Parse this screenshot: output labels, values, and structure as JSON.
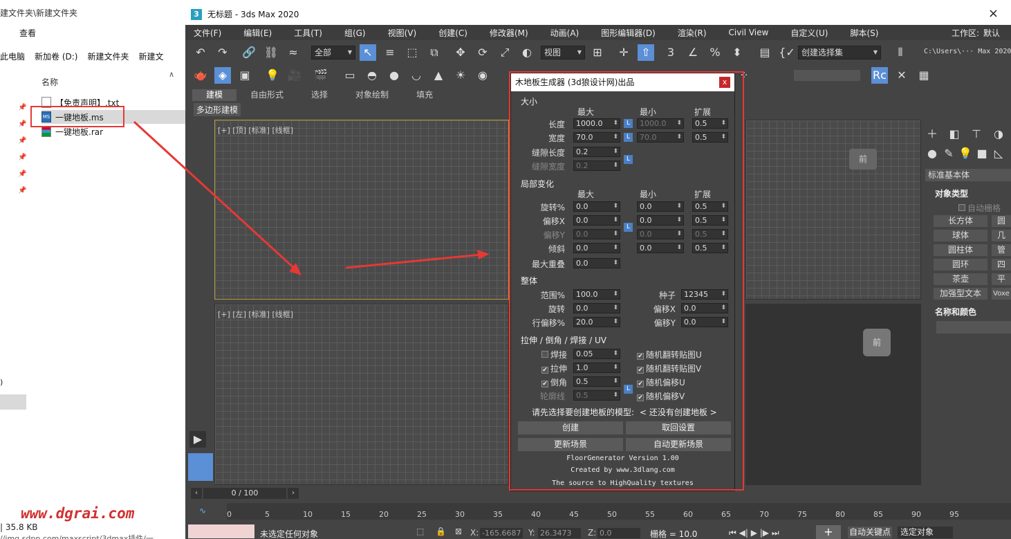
{
  "explorer": {
    "title_path": "建文件夹\\新建文件夹",
    "view_tab": "查看",
    "crumbs": [
      "此电脑",
      "新加卷 (D:)",
      "新建文件夹",
      "新建文"
    ],
    "column_name": "名称",
    "files": [
      {
        "name": "【免责声明】.txt"
      },
      {
        "name": "一键地板.ms"
      },
      {
        "name": "一键地板.rar"
      }
    ],
    "size": "35.8 KB",
    "url_fragment": "//img.sdpp.com/maxscript/3dmax插件/一",
    "side_paren": ")"
  },
  "watermark": "www.dgrai.com",
  "app": {
    "title": "无标题 - 3ds Max 2020",
    "close": "×",
    "menu": [
      "文件(F)",
      "编辑(E)",
      "工具(T)",
      "组(G)",
      "视图(V)",
      "创建(C)",
      "修改器(M)",
      "动画(A)",
      "图形编辑器(D)",
      "渲染(R)",
      "Civil View",
      "自定义(U)",
      "脚本(S)"
    ],
    "workspace_label": "工作区:",
    "workspace_value": "默认",
    "selection_filter": "全部",
    "view_dropdown": "视图",
    "selection_set": "创建选择集",
    "path_field": "C:\\Users\\··· Max 2020",
    "ribbon_tabs": [
      "建模",
      "自由形式",
      "选择",
      "对象绘制",
      "填充"
    ],
    "ribbon_sub": "多边形建模",
    "viewport_top_label": "[+] [顶] [标准] [线框]",
    "viewport_left_label": "[+] [左] [标准] [线框]",
    "viewcube_top": "前",
    "viewcube_left": "前"
  },
  "dialog": {
    "title": "木地板生成器 (3d狼设计网)出品",
    "close": "x",
    "size": {
      "heading": "大小",
      "col_max": "最大",
      "col_min": "最小",
      "col_ext": "扩展",
      "rows": [
        {
          "label": "长度",
          "max": "1000.0",
          "min": "1000.0",
          "ext": "0.5"
        },
        {
          "label": "宽度",
          "max": "70.0",
          "min": "70.0",
          "ext": "0.5"
        }
      ],
      "gap_len_label": "缝隙长度",
      "gap_len": "0.2",
      "gap_wid_label": "缝隙宽度",
      "gap_wid": "0.2"
    },
    "local": {
      "heading": "局部变化",
      "col_max": "最大",
      "col_min": "最小",
      "col_ext": "扩展",
      "rows": [
        {
          "label": "旋转%",
          "max": "0.0",
          "min": "0.0",
          "ext": "0.5"
        },
        {
          "label": "偏移X",
          "max": "0.0",
          "min": "0.0",
          "ext": "0.5"
        },
        {
          "label": "偏移Y",
          "max": "0.0",
          "min": "0.0",
          "ext": "0.5"
        },
        {
          "label": "倾斜",
          "max": "0.0",
          "min": "0.0",
          "ext": "0.5"
        }
      ],
      "overlap_label": "最大重叠",
      "overlap": "0.0"
    },
    "whole": {
      "heading": "整体",
      "range_label": "范围%",
      "range": "100.0",
      "seed_label": "种子",
      "seed": "12345",
      "rot_label": "旋转",
      "rot": "0.0",
      "offx_label": "偏移X",
      "offx": "0.0",
      "rowoff_label": "行偏移%",
      "rowoff": "20.0",
      "offy_label": "偏移Y",
      "offy": "0.0"
    },
    "uv": {
      "heading": "拉伸 / 倒角 / 焊接 / UV",
      "weld_label": "焊接",
      "weld": "0.05",
      "extrude_label": "拉伸",
      "extrude": "1.0",
      "chamfer_label": "倒角",
      "chamfer": "0.5",
      "outline_label": "轮廓线",
      "outline": "0.5",
      "flip_u": "随机翻转贴图U",
      "flip_v": "随机翻转贴图V",
      "off_u": "随机偏移U",
      "off_v": "随机偏移V",
      "check": "✔"
    },
    "prompt": "请先选择要创建地板的模型:",
    "model_value": "< 还没有创建地板 >",
    "buttons": {
      "create": "创建",
      "undo": "取回设置",
      "update": "更新场景",
      "auto_update": "自动更新场景"
    },
    "footer": [
      "FloorGenerator Version 1.00",
      "Created by www.3dlang.com",
      "The source to HighQuality textures"
    ]
  },
  "command_panel": {
    "category": "标准基本体",
    "object_type": "对象类型",
    "autogrid": "自动栅格",
    "objects": [
      "长方体",
      "圆",
      "球体",
      "几",
      "圆柱体",
      "管",
      "圆环",
      "四",
      "茶壶",
      "平",
      "加强型文本",
      "Voxe"
    ],
    "name_color": "名称和颜色"
  },
  "timeline": {
    "frame": "0 / 100",
    "ticks": [
      "0",
      "5",
      "10",
      "15",
      "20",
      "25",
      "30",
      "35",
      "40",
      "45",
      "50",
      "55",
      "60",
      "65",
      "70",
      "75",
      "80",
      "85",
      "90",
      "95"
    ]
  },
  "status": {
    "message": "未选定任何对象",
    "x_label": "X:",
    "x_value": "-165.6687",
    "y_label": "Y:",
    "y_value": "26.3473",
    "z_label": "Z:",
    "z_value": "0.0",
    "grid": "栅格 = 10.0",
    "auto_key": "自动关键点",
    "selected": "选定对象",
    "add_time_tag": "+"
  },
  "colors": {
    "highlight": "#e53935",
    "accent": "#5b8fd6"
  }
}
